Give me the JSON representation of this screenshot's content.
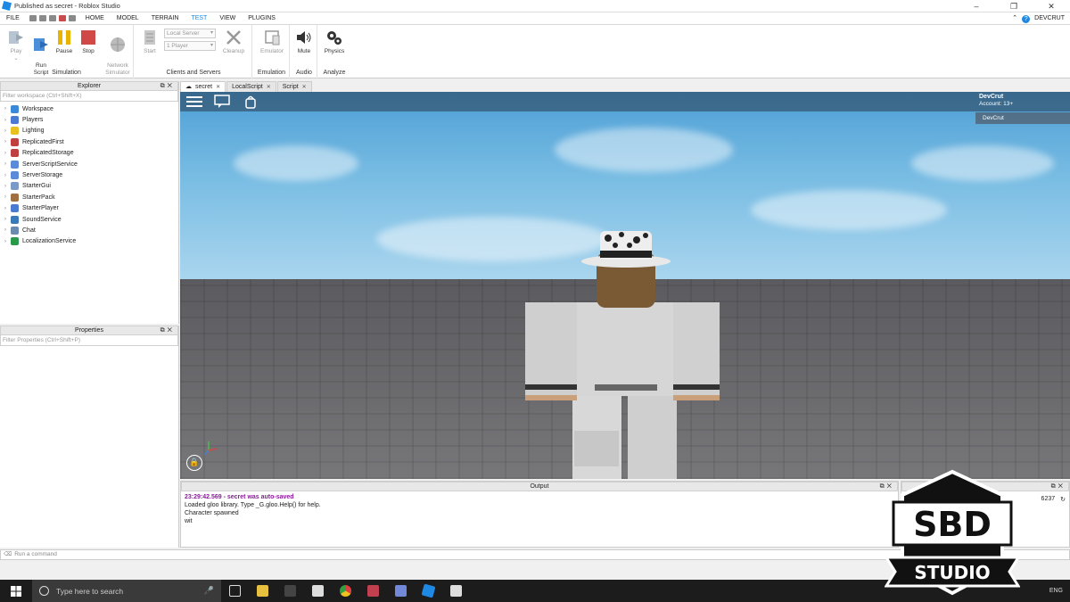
{
  "window": {
    "title": "Published as secret - Roblox Studio",
    "controls": [
      "–",
      "❐",
      "✕"
    ]
  },
  "menu": {
    "items": [
      "FILE",
      "HOME",
      "MODEL",
      "TERRAIN",
      "TEST",
      "VIEW",
      "PLUGINS"
    ],
    "active": "TEST",
    "user": "DEVCRUT",
    "accent_color": "#1e88e5"
  },
  "ribbon": {
    "simulation": {
      "label": "Simulation",
      "play": "Play",
      "run": "Run\nScript",
      "pause": "Pause",
      "stop": "Stop",
      "network": "Network\nSimulator"
    },
    "clients": {
      "label": "Clients and Servers",
      "start": "Start",
      "server_select": "Local Server",
      "players_select": "1 Player",
      "cleanup": "Cleanup"
    },
    "emulation": {
      "label": "Emulation",
      "emulator": "Emulator"
    },
    "audio": {
      "label": "Audio",
      "mute": "Mute"
    },
    "analyze": {
      "label": "Analyze",
      "physics": "Physics"
    }
  },
  "explorer": {
    "title": "Explorer",
    "filter_placeholder": "Filter workspace (Ctrl+Shift+X)",
    "items": [
      {
        "label": "Workspace",
        "icon": "workspace-icon",
        "color": "#3a88d8"
      },
      {
        "label": "Players",
        "icon": "players-icon",
        "color": "#4a7bd0"
      },
      {
        "label": "Lighting",
        "icon": "lighting-icon",
        "color": "#e8c020"
      },
      {
        "label": "ReplicatedFirst",
        "icon": "replicated-first-icon",
        "color": "#c04040"
      },
      {
        "label": "ReplicatedStorage",
        "icon": "replicated-storage-icon",
        "color": "#c04040"
      },
      {
        "label": "ServerScriptService",
        "icon": "server-script-service-icon",
        "color": "#5a8ad8"
      },
      {
        "label": "ServerStorage",
        "icon": "server-storage-icon",
        "color": "#5a8ad8"
      },
      {
        "label": "StarterGui",
        "icon": "starter-gui-icon",
        "color": "#7a9ac8"
      },
      {
        "label": "StarterPack",
        "icon": "starter-pack-icon",
        "color": "#a07040"
      },
      {
        "label": "StarterPlayer",
        "icon": "starter-player-icon",
        "color": "#4a7bd0"
      },
      {
        "label": "SoundService",
        "icon": "sound-service-icon",
        "color": "#3a7ab8"
      },
      {
        "label": "Chat",
        "icon": "chat-icon",
        "color": "#6a8ab0"
      },
      {
        "label": "LocalizationService",
        "icon": "localization-service-icon",
        "color": "#2a9a4a"
      }
    ]
  },
  "properties": {
    "title": "Properties",
    "filter_placeholder": "Filter Properties (Ctrl+Shift+P)"
  },
  "tabs": [
    {
      "label": "secret",
      "active": true
    },
    {
      "label": "LocalScript",
      "active": false
    },
    {
      "label": "Script",
      "active": false
    }
  ],
  "game": {
    "player_name": "DevCrut",
    "account": "Account: 13+",
    "list_entry": "DevCrut"
  },
  "output": {
    "title": "Output",
    "lines": [
      {
        "text": "23:29:42.569 - secret was auto-saved",
        "kind": "warn"
      },
      {
        "text": "Loaded gloo library. Type _G.gloo.Help() for help.",
        "kind": "normal"
      },
      {
        "text": "Character spawned",
        "kind": "normal"
      },
      {
        "text": "wit",
        "kind": "normal"
      }
    ]
  },
  "side_panel": {
    "partial_text": "6237"
  },
  "command_bar": {
    "placeholder": "Run a command"
  },
  "taskbar": {
    "search_placeholder": "Type here to search",
    "lang": "ENG"
  },
  "watermark": {
    "top": "SBD",
    "bottom": "STUDIO"
  }
}
